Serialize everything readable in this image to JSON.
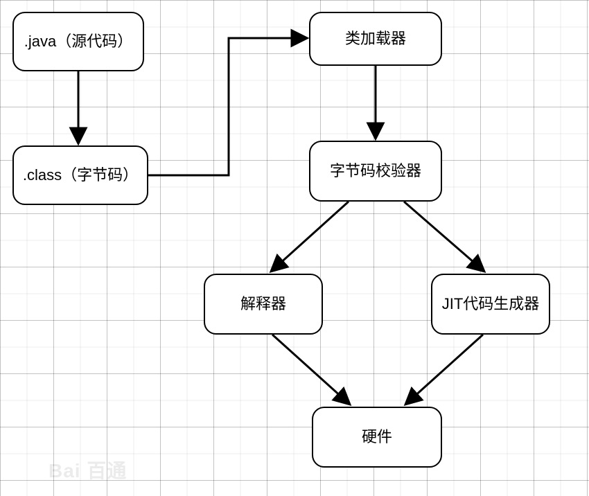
{
  "diagram": {
    "type": "flowchart",
    "nodes": {
      "java_source": {
        "label": ".java（源代码）"
      },
      "class_bytecode": {
        "label": ".class（字节码）"
      },
      "class_loader": {
        "label": "类加载器"
      },
      "verifier": {
        "label": "字节码校验器"
      },
      "interpreter": {
        "label": "解释器"
      },
      "jit": {
        "label": "JIT代码生成器"
      },
      "hardware": {
        "label": "硬件"
      }
    },
    "edges": [
      {
        "from": "java_source",
        "to": "class_bytecode"
      },
      {
        "from": "class_bytecode",
        "to": "class_loader"
      },
      {
        "from": "class_loader",
        "to": "verifier"
      },
      {
        "from": "verifier",
        "to": "interpreter"
      },
      {
        "from": "verifier",
        "to": "jit"
      },
      {
        "from": "interpreter",
        "to": "hardware"
      },
      {
        "from": "jit",
        "to": "hardware"
      }
    ],
    "watermark": "Bai 百通"
  }
}
